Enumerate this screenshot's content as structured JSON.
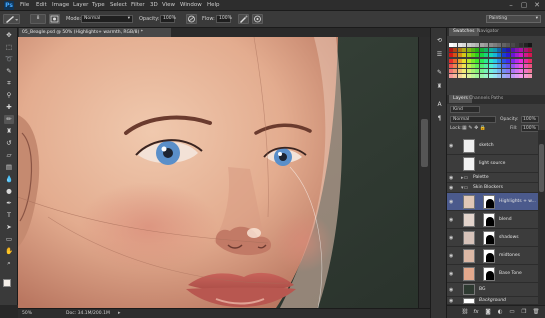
{
  "app": {
    "logo": "Ps"
  },
  "menu": [
    "File",
    "Edit",
    "Image",
    "Layer",
    "Type",
    "Select",
    "Filter",
    "3D",
    "View",
    "Window",
    "Help"
  ],
  "window_controls": [
    "–",
    "▢",
    "✕"
  ],
  "options": {
    "mode_label": "Mode:",
    "mode_value": "Normal",
    "opacity_label": "Opacity:",
    "opacity_value": "100%",
    "flow_label": "Flow:",
    "flow_value": "100%",
    "workspace": "Painting",
    "brush_size": "8"
  },
  "document": {
    "tab_title": "05_Beagle.psd @ 50% (Highlights+ warmth, RGB/8) *"
  },
  "status": {
    "zoom": "50%",
    "doc": "Doc: 34.1M/200.1M"
  },
  "panels": {
    "top_tabs": [
      "Swatches",
      "Navigator"
    ],
    "layer_tabs": [
      "Layers",
      "Channels",
      "Paths"
    ],
    "kind_label": "Kind",
    "blend_mode": "Normal",
    "opacity_label": "Opacity:",
    "opacity_value": "100%",
    "lock_label": "Lock:",
    "fill_label": "Fill:",
    "fill_value": "100%"
  },
  "layers": [
    {
      "name": "sketch",
      "type": "layer"
    },
    {
      "name": "light source",
      "type": "layer"
    },
    {
      "name": "Palette",
      "type": "group"
    },
    {
      "name": "Skin Blockers",
      "type": "group"
    },
    {
      "name": "Highlights + w...",
      "type": "masked"
    },
    {
      "name": "blend",
      "type": "masked"
    },
    {
      "name": "shadows",
      "type": "masked"
    },
    {
      "name": "midtones",
      "type": "masked"
    },
    {
      "name": "Base Tone",
      "type": "masked"
    },
    {
      "name": "BG",
      "type": "layer"
    },
    {
      "name": "Background",
      "type": "layer"
    }
  ],
  "colors": {
    "accent": "#4b5a8c",
    "canvas_bg": "#2f3b33",
    "skin": "#e7b69a",
    "iris": "#5a8fc9"
  },
  "icons": {
    "toolbar": [
      "move-icon",
      "marquee-icon",
      "lasso-icon",
      "quick-select-icon",
      "crop-icon",
      "eyedropper-icon",
      "healing-icon",
      "brush-icon",
      "clone-stamp-icon",
      "history-brush-icon",
      "eraser-icon",
      "gradient-icon",
      "blur-icon",
      "dodge-icon",
      "pen-icon",
      "type-icon",
      "path-select-icon",
      "shape-icon",
      "hand-icon",
      "zoom-icon"
    ],
    "footer": [
      "link-icon",
      "fx-icon",
      "mask-icon",
      "adjustment-icon",
      "folder-icon",
      "new-layer-icon",
      "trash-icon"
    ]
  }
}
